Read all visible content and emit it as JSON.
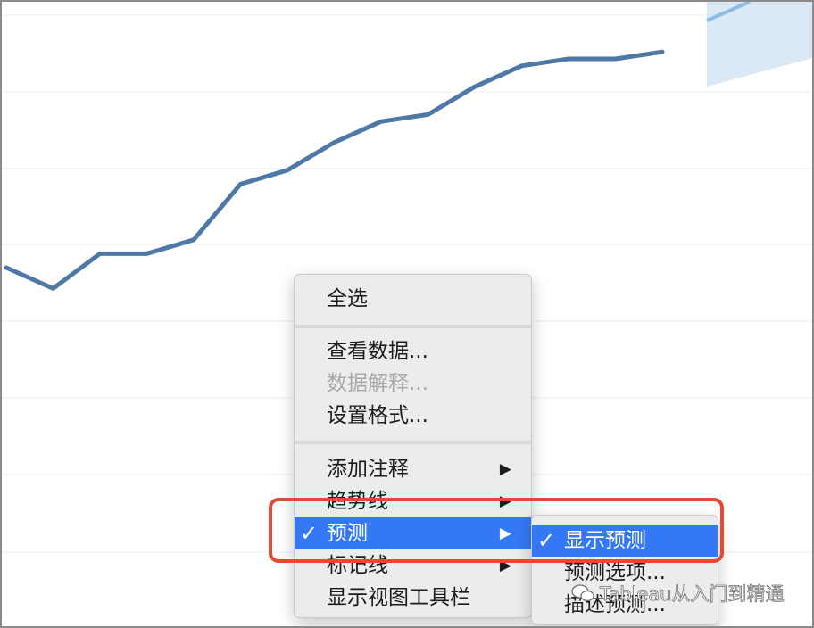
{
  "colors": {
    "line": "#4e79a7",
    "forecast_band": "#dbe9f6",
    "forecast_line": "#8fbbe4",
    "gridline": "#ebebeb",
    "menu_bg": "#ececec",
    "selected_bg": "#3478f6",
    "highlight_border": "#e34a30"
  },
  "chart_data": {
    "type": "line",
    "grid": true,
    "series": [
      {
        "values": [
          4.0,
          3.7,
          4.2,
          4.2,
          4.4,
          5.2,
          5.4,
          5.8,
          6.1,
          6.2,
          6.6,
          6.9,
          7.0,
          7.0,
          7.1
        ]
      }
    ]
  },
  "context_menu": {
    "sections": [
      [
        {
          "label": "全选",
          "enabled": true
        }
      ],
      [
        {
          "label": "查看数据...",
          "enabled": true
        },
        {
          "label": "数据解释...",
          "enabled": false
        },
        {
          "label": "设置格式...",
          "enabled": true
        }
      ],
      [
        {
          "label": "添加注释",
          "submenu_arrow": "▶"
        },
        {
          "label": "趋势线",
          "submenu_arrow": "▶"
        },
        {
          "label": "预测",
          "submenu_arrow": "▶",
          "checked": true,
          "selected": true
        },
        {
          "label": "标记线",
          "submenu_arrow": "▶"
        },
        {
          "label": "显示视图工具栏"
        }
      ]
    ],
    "check_glyph": "✓"
  },
  "forecast_submenu": {
    "items": [
      {
        "label": "显示预测",
        "checked": true,
        "selected": true
      },
      {
        "label": "预测选项..."
      },
      {
        "label": "描述预测..."
      }
    ]
  },
  "watermark": {
    "text": "Tableau从入门到精通"
  }
}
